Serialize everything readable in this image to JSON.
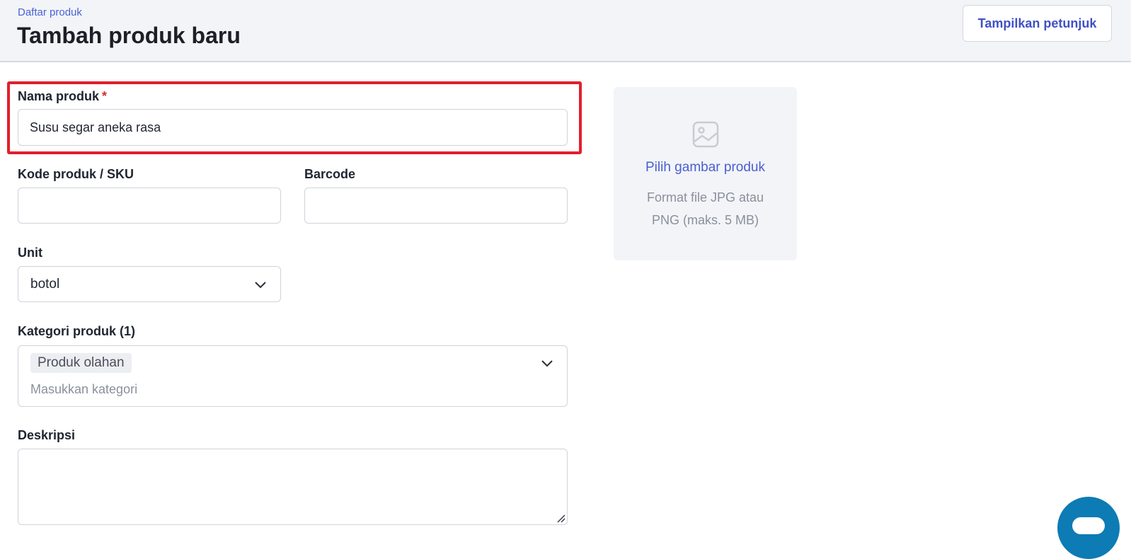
{
  "header": {
    "breadcrumb": "Daftar produk",
    "title": "Tambah produk baru",
    "hint_button": "Tampilkan petunjuk"
  },
  "form": {
    "product_name": {
      "label": "Nama produk",
      "required_mark": "*",
      "value": "Susu segar aneka rasa"
    },
    "sku": {
      "label": "Kode produk / SKU",
      "value": ""
    },
    "barcode": {
      "label": "Barcode",
      "value": ""
    },
    "unit": {
      "label": "Unit",
      "value": "botol"
    },
    "category": {
      "label": "Kategori produk (1)",
      "chips": [
        "Produk olahan"
      ],
      "placeholder": "Masukkan kategori"
    },
    "description": {
      "label": "Deskripsi",
      "value": ""
    }
  },
  "image_upload": {
    "link": "Pilih gambar produk",
    "hint_line1": "Format file JPG atau",
    "hint_line2": "PNG (maks. 5 MB)"
  },
  "colors": {
    "accent": "#3f51c4",
    "highlight": "#e21f2b",
    "header_bg": "#f2f4f8",
    "chat_button": "#0d7bb4"
  },
  "icons": {
    "image_placeholder": "image-icon",
    "dropdown": "chevron-down-icon",
    "resize": "resize-handle-icon",
    "chat": "chat-icon"
  }
}
